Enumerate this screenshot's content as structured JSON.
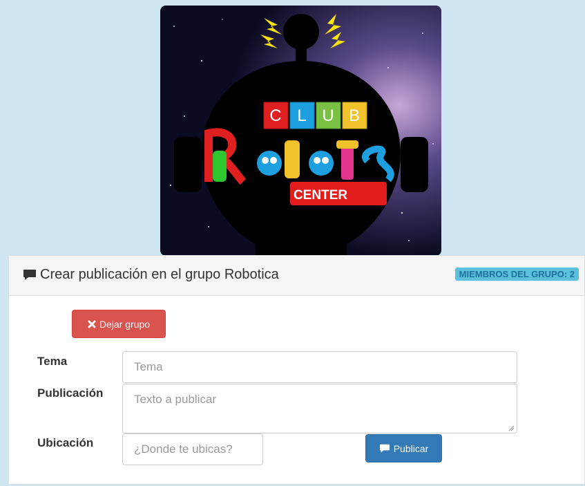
{
  "logo": {
    "club_letters": [
      "C",
      "L",
      "U",
      "B"
    ],
    "word": "Robot's",
    "tag": "CENTER",
    "colors": {
      "space_bg": "#1a1a3a",
      "robot_body": "#000000",
      "tile_c": "#e02020",
      "tile_l": "#1ea0e0",
      "tile_u": "#7ac143",
      "tile_b": "#f2c22b",
      "lightning": "#ffe600",
      "center_tag": "#e21d1d"
    }
  },
  "panel": {
    "title": "Crear publicación en el grupo Robotica",
    "title_icon": "comment-icon",
    "members_badge": "MIEMBROS DEL GRUPO: 2",
    "badge_color": "#5bc0de"
  },
  "actions": {
    "leave_group": "Dejar grupo",
    "leave_icon": "close-icon",
    "publish": "Publicar",
    "publish_icon": "comment-icon"
  },
  "form": {
    "topic_label": "Tema",
    "topic_placeholder": "Tema",
    "post_label": "Publicación",
    "post_placeholder": "Texto a publicar",
    "location_label": "Ubicación",
    "location_placeholder": "¿Donde te ubicas?"
  }
}
